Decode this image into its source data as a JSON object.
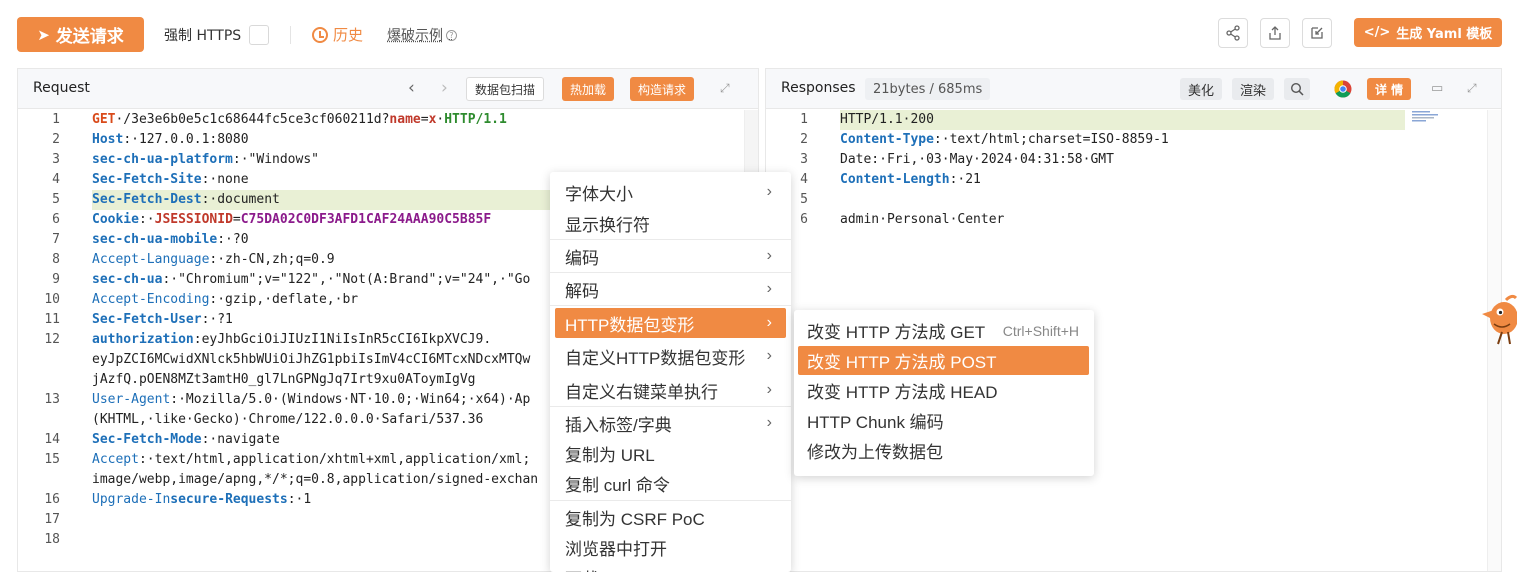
{
  "toolbar": {
    "send_label": "发送请求",
    "https_label": "强制 HTTPS",
    "history_label": "历史",
    "fuzz_label": "爆破示例",
    "yaml_label": "生成 Yaml 模板",
    "icons": [
      "share-icon",
      "export-icon",
      "edit-icon"
    ]
  },
  "request": {
    "title": "Request",
    "scan_label": "数据包扫描",
    "hotload_label": "热加载",
    "build_label": "构造请求",
    "lines": [
      {
        "n": "1",
        "parts": [
          [
            "m",
            "GET"
          ],
          [
            "",
            "·/3e3e6b0e5c1c68644fc5ce3cf060211d?"
          ],
          [
            "p",
            "name"
          ],
          [
            "",
            "="
          ],
          [
            "p",
            "x"
          ],
          [
            "",
            "·"
          ],
          [
            "g",
            "HTTP/1.1"
          ]
        ]
      },
      {
        "n": "2",
        "parts": [
          [
            "k",
            "Host"
          ],
          [
            "",
            ":·127.0.0.1:8080"
          ]
        ]
      },
      {
        "n": "3",
        "parts": [
          [
            "k",
            "sec-ch-ua-platform"
          ],
          [
            "",
            ":·\"Windows\""
          ]
        ]
      },
      {
        "n": "4",
        "parts": [
          [
            "k",
            "Sec-Fetch-Site"
          ],
          [
            "",
            ":·none"
          ]
        ]
      },
      {
        "n": "5",
        "parts": [
          [
            "k",
            "Sec-Fetch-Dest"
          ],
          [
            "",
            ":·document"
          ]
        ]
      },
      {
        "n": "6",
        "parts": [
          [
            "k",
            "Cookie"
          ],
          [
            "",
            ":·"
          ],
          [
            "ck",
            "JSESSIONID"
          ],
          [
            "",
            "="
          ],
          [
            "cv",
            "C75DA02C0DF3AFD1CAF24AAA90C5B85F"
          ]
        ]
      },
      {
        "n": "7",
        "parts": [
          [
            "k",
            "sec-ch-ua-mobile"
          ],
          [
            "",
            ":·?0"
          ]
        ]
      },
      {
        "n": "8",
        "parts": [
          [
            "kn",
            "Accept-Language"
          ],
          [
            "",
            ":·zh-CN,zh;q=0.9"
          ]
        ]
      },
      {
        "n": "9",
        "parts": [
          [
            "k",
            "sec-ch-ua"
          ],
          [
            "",
            ":·\"Chromium\";v=\"122\",·\"Not(A:Brand\";v=\"24\",·\"Go"
          ]
        ]
      },
      {
        "n": "10",
        "parts": [
          [
            "kn",
            "Accept-Encoding"
          ],
          [
            "",
            ":·gzip,·deflate,·br"
          ]
        ]
      },
      {
        "n": "11",
        "parts": [
          [
            "k",
            "Sec-Fetch-User"
          ],
          [
            "",
            ":·?1"
          ]
        ]
      },
      {
        "n": "12",
        "parts": [
          [
            "k",
            "authorization"
          ],
          [
            "",
            ":eyJhbGciOiJIUzI1NiIsInR5cCI6IkpXVCJ9."
          ]
        ]
      },
      {
        "n": "",
        "parts": [
          [
            "",
            "eyJpZCI6MCwidXNlck5hbWUiOiJhZG1pbiIsImV4cCI6MTcxNDcxMTQw"
          ]
        ]
      },
      {
        "n": "",
        "parts": [
          [
            "",
            "jAzfQ.pOEN8MZt3amtH0_gl7LnGPNgJq7Irt9xu0AToymIgVg"
          ]
        ]
      },
      {
        "n": "13",
        "parts": [
          [
            "kn",
            "User-Agent"
          ],
          [
            "",
            ":·Mozilla/5.0·(Windows·NT·10.0;·Win64;·x64)·Ap"
          ]
        ]
      },
      {
        "n": "",
        "parts": [
          [
            "",
            "(KHTML,·like·Gecko)·Chrome/122.0.0.0·Safari/537.36"
          ]
        ]
      },
      {
        "n": "14",
        "parts": [
          [
            "k",
            "Sec-Fetch-Mode"
          ],
          [
            "",
            ":·navigate"
          ]
        ]
      },
      {
        "n": "15",
        "parts": [
          [
            "kn",
            "Accept"
          ],
          [
            "",
            ":·text/html,application/xhtml+xml,application/xml;"
          ]
        ]
      },
      {
        "n": "",
        "parts": [
          [
            "",
            "image/webp,image/apng,*/*;q=0.8,application/signed-exchan"
          ]
        ]
      },
      {
        "n": "16",
        "parts": [
          [
            "kn",
            "Upgrade-In"
          ],
          [
            "k",
            "secure-Requests"
          ],
          [
            "",
            ":·1"
          ]
        ]
      },
      {
        "n": "17",
        "parts": [
          [
            "",
            ""
          ]
        ]
      },
      {
        "n": "18",
        "parts": [
          [
            "",
            ""
          ]
        ]
      }
    ]
  },
  "response": {
    "title": "Responses",
    "size_label": "21bytes / 685ms",
    "beautify_label": "美化",
    "render_label": "渲染",
    "detail_label": "详 情",
    "lines": [
      {
        "n": "1",
        "parts": [
          [
            "",
            "HTTP/1.1·200"
          ]
        ]
      },
      {
        "n": "2",
        "parts": [
          [
            "k",
            "Content-Type"
          ],
          [
            "",
            ":·text/html;charset=ISO-8859-1"
          ]
        ]
      },
      {
        "n": "3",
        "parts": [
          [
            "",
            "Date:·Fri,·03·May·2024·04:31:58·GMT"
          ]
        ]
      },
      {
        "n": "4",
        "parts": [
          [
            "k",
            "Content-Length"
          ],
          [
            "",
            ":·21"
          ]
        ]
      },
      {
        "n": "5",
        "parts": [
          [
            "",
            ""
          ]
        ]
      },
      {
        "n": "6",
        "parts": [
          [
            "",
            "admin·Personal·Center"
          ]
        ]
      }
    ]
  },
  "context_menu": {
    "items": [
      {
        "label": "字体大小",
        "arrow": true
      },
      {
        "label": "显示换行符",
        "arrow": false
      },
      {
        "label": "编码",
        "arrow": true
      },
      {
        "label": "解码",
        "arrow": true
      },
      {
        "label": "HTTP数据包变形",
        "arrow": true,
        "active": true
      },
      {
        "label": "自定义HTTP数据包变形",
        "arrow": true
      },
      {
        "label": "自定义右键菜单执行",
        "arrow": true
      },
      {
        "label": "插入标签/字典",
        "arrow": true
      },
      {
        "label": "复制为 URL",
        "arrow": false
      },
      {
        "label": "复制 curl 命令",
        "arrow": false
      },
      {
        "label": "复制为 CSRF PoC",
        "arrow": false
      },
      {
        "label": "浏览器中打开",
        "arrow": false
      },
      {
        "label": "下载 Body",
        "arrow": false
      }
    ]
  },
  "submenu": {
    "items": [
      {
        "label": "改变 HTTP 方法成 GET",
        "shortcut": "Ctrl+Shift+H"
      },
      {
        "label": "改变 HTTP 方法成 POST",
        "active": true
      },
      {
        "label": "改变 HTTP 方法成 HEAD"
      },
      {
        "label": "HTTP Chunk 编码"
      },
      {
        "label": "修改为上传数据包"
      }
    ]
  },
  "colors": {
    "accent": "#f08a43",
    "keyword": "#1d6fb8",
    "highlight_line": "#e9f0d5"
  }
}
